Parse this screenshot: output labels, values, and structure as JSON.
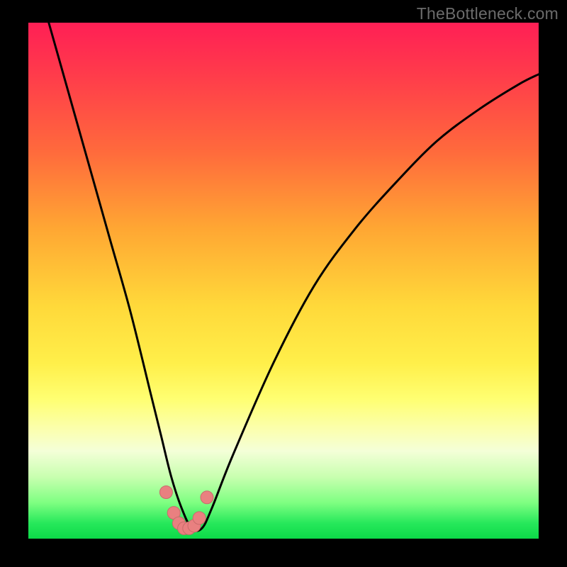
{
  "watermark": "TheBottleneck.com",
  "colors": {
    "background": "#000000",
    "curve": "#000000",
    "marker_fill": "#e98080",
    "marker_stroke": "#c96b6b"
  },
  "chart_data": {
    "type": "line",
    "title": "",
    "xlabel": "",
    "ylabel": "",
    "xlim": [
      0,
      100
    ],
    "ylim": [
      0,
      100
    ],
    "note": "Axes are unlabeled; values are pixel-normalized 0–100 estimates read from the rendered curve (0,0 = bottom-left, 100,100 = top-left).",
    "series": [
      {
        "name": "bottleneck-curve",
        "x": [
          4,
          8,
          12,
          16,
          20,
          24,
          26,
          28,
          30,
          32,
          34,
          36,
          40,
          48,
          56,
          64,
          72,
          80,
          88,
          96,
          100
        ],
        "y": [
          100,
          86,
          72,
          58,
          44,
          28,
          20,
          12,
          6,
          2,
          2,
          6,
          16,
          34,
          49,
          60,
          69,
          77,
          83,
          88,
          90
        ]
      }
    ],
    "markers": {
      "name": "valley-cluster",
      "x": [
        27.0,
        28.5,
        29.5,
        30.5,
        31.5,
        32.5,
        33.5,
        35.0
      ],
      "y": [
        9.0,
        5.0,
        3.0,
        2.0,
        2.0,
        2.5,
        4.0,
        8.0
      ]
    }
  }
}
